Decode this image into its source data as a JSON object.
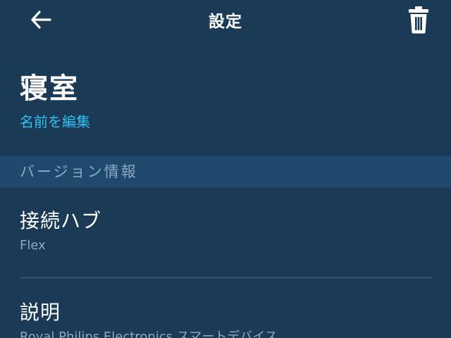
{
  "header": {
    "title": "設定",
    "back_icon": "arrow-left-icon",
    "delete_icon": "trash-icon"
  },
  "device": {
    "name": "寝室",
    "edit_label": "名前を編集"
  },
  "section": {
    "version_info": "バージョン情報"
  },
  "rows": {
    "hub": {
      "title": "接続ハブ",
      "value": "Flex"
    },
    "description": {
      "title": "説明",
      "value": "Royal Philips Electronics スマートデバイス"
    }
  },
  "colors": {
    "background": "#1a3a55",
    "section_header_bg": "#1f4a6e",
    "accent_link": "#30c0f0",
    "secondary_text": "#8aa9c3",
    "divider": "#4a6a86"
  }
}
